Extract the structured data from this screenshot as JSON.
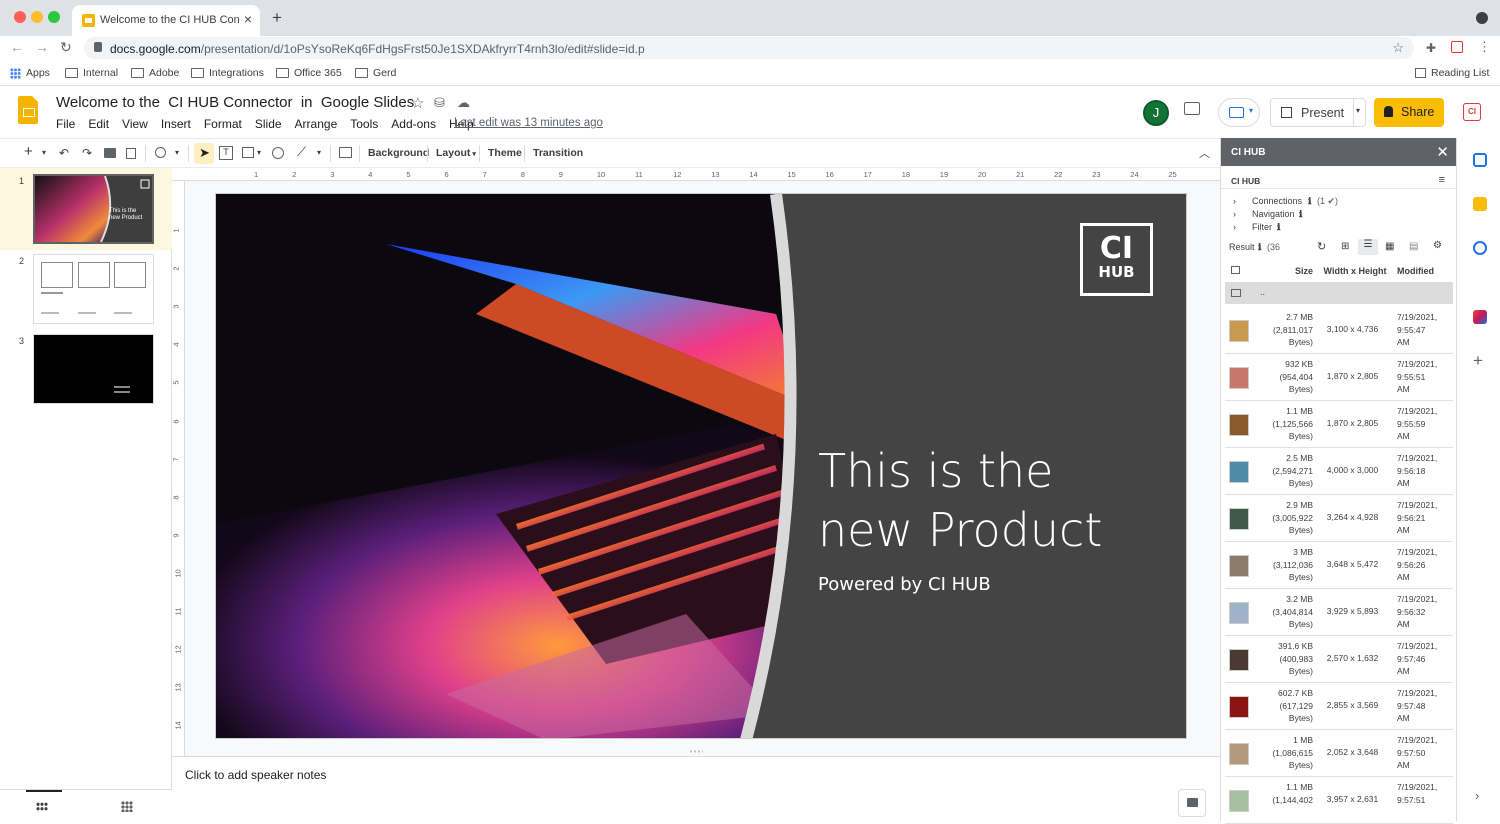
{
  "browser": {
    "tab_title": "Welcome to the CI HUB Conne",
    "url_host": "docs.google.com",
    "url_path": "/presentation/d/1oPsYsoReKq6FdHgsFrst50Je1SXDAkfryrrT4rnh3lo/edit#slide=id.p",
    "bookmarks": [
      "Apps",
      "Internal",
      "Adobe",
      "Integrations",
      "Office 365",
      "Gerd"
    ],
    "reading_list": "Reading List"
  },
  "doc": {
    "title": "Welcome to the  CI HUB Connector  in  Google Slides",
    "menu": [
      "File",
      "Edit",
      "View",
      "Insert",
      "Format",
      "Slide",
      "Arrange",
      "Tools",
      "Add-ons",
      "Help"
    ],
    "last_edit": "Last edit was 13 minutes ago",
    "avatar_initial": "J",
    "present_label": "Present",
    "share_label": "Share",
    "badge_text": "CI"
  },
  "toolbar": {
    "background": "Background",
    "layout": "Layout",
    "theme": "Theme",
    "transition": "Transition"
  },
  "filmstrip": {
    "numbers": [
      "1",
      "2",
      "3"
    ],
    "thumb1_text": "This is the new Product"
  },
  "ruler": {
    "h": [
      "1",
      "2",
      "3",
      "4",
      "5",
      "6",
      "7",
      "8",
      "9",
      "10",
      "11",
      "12",
      "13",
      "14",
      "15",
      "16",
      "17",
      "18",
      "19",
      "20",
      "21",
      "22",
      "23",
      "24",
      "25"
    ],
    "v": [
      "1",
      "2",
      "3",
      "4",
      "5",
      "6",
      "7",
      "8",
      "9",
      "10",
      "11",
      "12",
      "13",
      "14"
    ]
  },
  "slide": {
    "title_line1": "This is the",
    "title_line2": "new Product",
    "subtitle": "Powered by CI HUB",
    "logo_top": "CI",
    "logo_bottom": "HUB"
  },
  "notes": {
    "placeholder": "Click to add speaker notes"
  },
  "cihub": {
    "header": "CI HUB",
    "section_title": "CI HUB",
    "tree": [
      "Connections",
      "Navigation",
      "Filter"
    ],
    "connections_count": "(1 ✔)",
    "result_label": "Result",
    "result_count": "(36",
    "columns": {
      "size": "Size",
      "dims": "Width x Height",
      "modified": "Modified"
    },
    "folder_up": "..",
    "files": [
      {
        "size": "2.7 MB",
        "bytes": "(2,811,017",
        "unit": "Bytes)",
        "dims": "3,100 x 4,736",
        "date": "7/19/2021,",
        "time": "9:55:47",
        "ampm": "AM"
      },
      {
        "size": "932 KB",
        "bytes": "(954,404",
        "unit": "Bytes)",
        "dims": "1,870 x 2,805",
        "date": "7/19/2021,",
        "time": "9:55:51",
        "ampm": "AM"
      },
      {
        "size": "1.1 MB",
        "bytes": "(1,125,566",
        "unit": "Bytes)",
        "dims": "1,870 x 2,805",
        "date": "7/19/2021,",
        "time": "9:55:59",
        "ampm": "AM"
      },
      {
        "size": "2.5 MB",
        "bytes": "(2,594,271",
        "unit": "Bytes)",
        "dims": "4,000 x 3,000",
        "date": "7/19/2021,",
        "time": "9:56:18",
        "ampm": "AM"
      },
      {
        "size": "2.9 MB",
        "bytes": "(3,005,922",
        "unit": "Bytes)",
        "dims": "3,264 x 4,928",
        "date": "7/19/2021,",
        "time": "9:56:21",
        "ampm": "AM"
      },
      {
        "size": "3 MB",
        "bytes": "(3,112,036",
        "unit": "Bytes)",
        "dims": "3,648 x 5,472",
        "date": "7/19/2021,",
        "time": "9:56:26",
        "ampm": "AM"
      },
      {
        "size": "3.2 MB",
        "bytes": "(3,404,814",
        "unit": "Bytes)",
        "dims": "3,929 x 5,893",
        "date": "7/19/2021,",
        "time": "9:56:32",
        "ampm": "AM"
      },
      {
        "size": "391.6 KB",
        "bytes": "(400,983",
        "unit": "Bytes)",
        "dims": "2,570 x 1,632",
        "date": "7/19/2021,",
        "time": "9:57:46",
        "ampm": "AM"
      },
      {
        "size": "602.7 KB",
        "bytes": "(617,129",
        "unit": "Bytes)",
        "dims": "2,855 x 3,569",
        "date": "7/19/2021,",
        "time": "9:57:48",
        "ampm": "AM"
      },
      {
        "size": "1 MB",
        "bytes": "(1,086,615",
        "unit": "Bytes)",
        "dims": "2,052 x 3,648",
        "date": "7/19/2021,",
        "time": "9:57:50",
        "ampm": "AM"
      },
      {
        "size": "1.1 MB",
        "bytes": "(1,144,402",
        "unit": "",
        "dims": "3,957 x 2,631",
        "date": "7/19/2021,",
        "time": "9:57:51",
        "ampm": ""
      }
    ],
    "thumb_colors": [
      "#c79a4e",
      "#c8776b",
      "#8a5a2c",
      "#4f8aa8",
      "#3f5a4a",
      "#8c7b6a",
      "#9fb3c8",
      "#4b3a33",
      "#8b1414",
      "#b39a7a",
      "#a8c0a0"
    ]
  },
  "colors": {
    "share_yellow": "#fbbc04",
    "slides_yellow": "#f4b400",
    "panel_header": "#5f6368"
  }
}
